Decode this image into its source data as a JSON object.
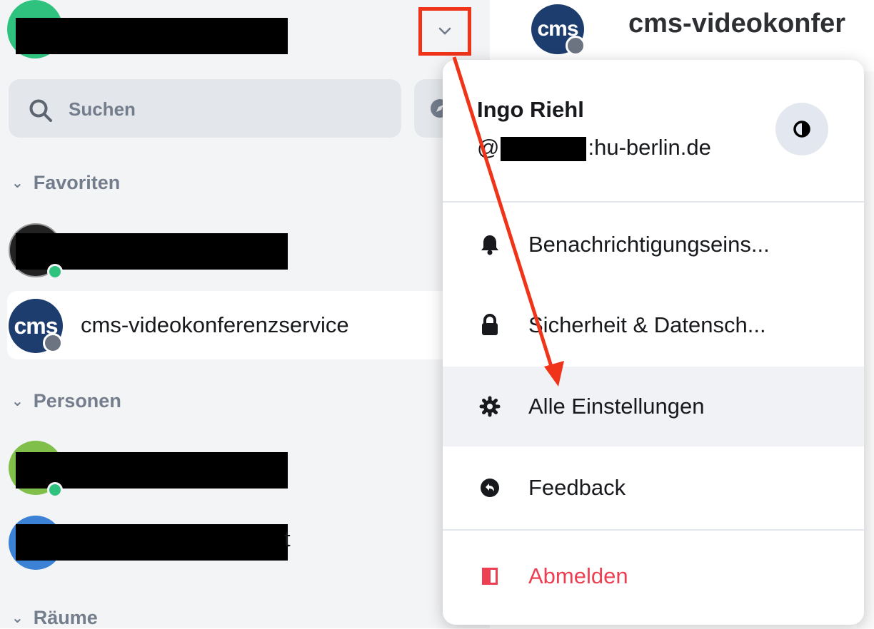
{
  "sidebar": {
    "search_placeholder": "Suchen",
    "sections": {
      "favorites": "Favoriten",
      "people": "Personen",
      "rooms": "Räume"
    },
    "rooms": [
      {
        "name": "cms-videokonferenzservice",
        "avatar_text": "cms"
      }
    ],
    "partial_text": "t"
  },
  "main": {
    "room_title": "cms-videokonfer",
    "avatar_text": "cms"
  },
  "user_menu": {
    "display_name": "Ingo Riehl",
    "user_id_prefix": "@",
    "user_id_suffix": ":hu-berlin.de",
    "items": [
      {
        "label": "Benachrichtigungseins...",
        "icon": "bell-icon"
      },
      {
        "label": "Sicherheit & Datensch...",
        "icon": "lock-icon"
      },
      {
        "label": "Alle Einstellungen",
        "icon": "gear-icon"
      },
      {
        "label": "Feedback",
        "icon": "feedback-icon"
      },
      {
        "label": "Abmelden",
        "icon": "sign-out-icon"
      }
    ]
  },
  "colors": {
    "annotation": "#f0341a",
    "danger": "#ee3f52",
    "cms_blue": "#1d3d6e"
  }
}
